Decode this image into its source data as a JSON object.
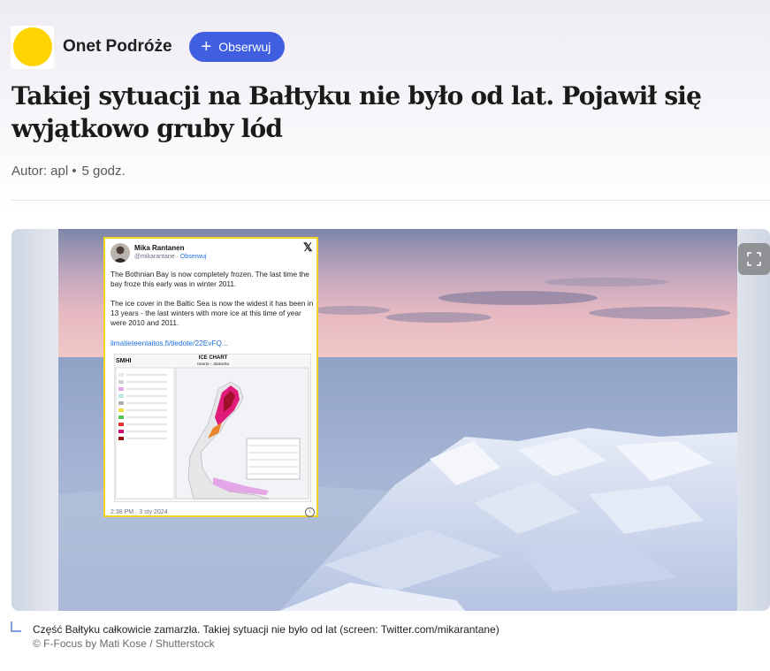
{
  "header": {
    "source_name": "Onet Podróże",
    "follow_label": "Obserwuj",
    "logo_color": "#ffd400",
    "accent_color": "#3f5fe0"
  },
  "article": {
    "title": "Takiej sytuacji na Bałtyku nie było od lat. Pojawił się wyjątkowo gruby lód",
    "author": "Autor: apl",
    "time": "5 godz."
  },
  "embedded_tweet": {
    "author_name": "Mika Rantanen",
    "handle": "@mikarantane",
    "follow": "Obserwuj",
    "paragraph_1": "The Bothnian Bay is now completely frozen. The last time the bay froze this early was in winter 2011.",
    "paragraph_2": "The ice cover in the Baltic Sea is now the widest it has been in 13 years - the last winters with more ice at this time of year were 2010 and 2011.",
    "link": "ilmatieteenlaitos.fi/tiedote/22EvFQ...",
    "chart_org": "SMHI",
    "chart_title": "ICE CHART",
    "chart_subtitle": "Iskarta - Jääkartta",
    "timestamp": "2:38 PM · 3 sty 2024"
  },
  "caption": {
    "text": "Część Bałtyku całkowicie zamarzła. Takiej sytuacji nie było od lat (screen: Twitter.com/mikarantane)",
    "credit": "© F-Focus by Mati Kose / Shutterstock"
  }
}
